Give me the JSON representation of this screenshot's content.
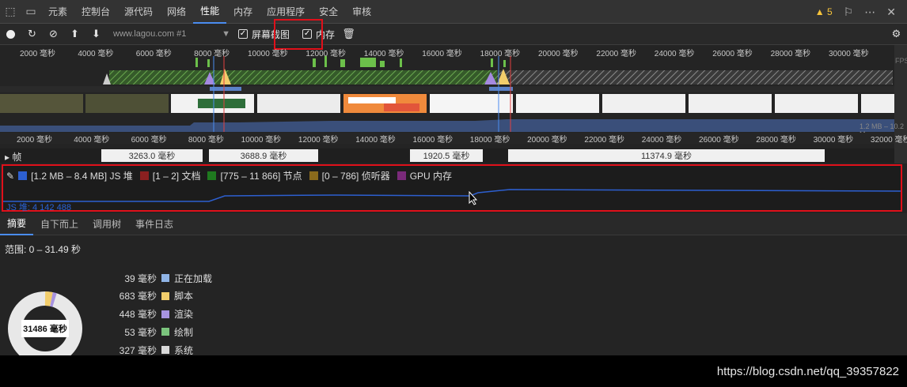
{
  "tabs": {
    "items": [
      "元素",
      "控制台",
      "源代码",
      "网络",
      "性能",
      "内存",
      "应用程序",
      "安全",
      "审核"
    ],
    "active_index": 4,
    "warning_count": "5"
  },
  "toolbar": {
    "url": "www.lagou.com #1",
    "screenshot_label": "屏幕截图",
    "screenshot_checked": true,
    "memory_label": "内存",
    "memory_checked": true
  },
  "overview": {
    "ticks_top": [
      "2000 毫秒",
      "4000 毫秒",
      "6000 毫秒",
      "8000 毫秒",
      "10000 毫秒",
      "12000 毫秒",
      "14000 毫秒",
      "16000 毫秒",
      "18000 毫秒",
      "20000 毫秒",
      "22000 毫秒",
      "24000 毫秒",
      "26000 毫秒",
      "28000 毫秒",
      "30000 毫秒"
    ],
    "ticks_bottom": [
      "2000 毫秒",
      "4000 毫秒",
      "6000 毫秒",
      "8000 毫秒",
      "10000 毫秒",
      "12000 毫秒",
      "14000 毫秒",
      "16000 毫秒",
      "18000 毫秒",
      "20000 毫秒",
      "22000 毫秒",
      "24000 毫秒",
      "26000 毫秒",
      "28000 毫秒",
      "30000 毫秒",
      "32000 毫秒"
    ],
    "fps_label": "FPS",
    "mem_range": "1.2 MB – 10.2 M"
  },
  "frames": {
    "label": "帧",
    "cells": [
      "3263.0 毫秒",
      "3688.9 毫秒",
      "1920.5 毫秒",
      "11374.9 毫秒"
    ]
  },
  "memory": {
    "legend": [
      {
        "label": "[1.2 MB – 8.4 MB] JS 堆",
        "color": "#2d5fd0"
      },
      {
        "label": "[1 – 2] 文档",
        "color": "#8b2020"
      },
      {
        "label": "[775 – 11 866] 节点",
        "color": "#1f7a1f"
      },
      {
        "label": "[0 – 786] 侦听器",
        "color": "#8a6a1c"
      },
      {
        "label": "GPU 内存",
        "color": "#7a2a7a"
      }
    ],
    "js_heap": "JS 堆: 4 142 488"
  },
  "bottom_tabs": [
    "摘要",
    "自下而上",
    "调用树",
    "事件日志"
  ],
  "summary": {
    "range": "范围: 0 – 31.49 秒",
    "total": "31486 毫秒",
    "stats": [
      {
        "value": "39 毫秒",
        "label": "正在加载",
        "color": "#8fb4e6"
      },
      {
        "value": "683 毫秒",
        "label": "脚本",
        "color": "#f2cd6b"
      },
      {
        "value": "448 毫秒",
        "label": "渲染",
        "color": "#a793e0"
      },
      {
        "value": "53 毫秒",
        "label": "绘制",
        "color": "#7bc47d"
      },
      {
        "value": "327 毫秒",
        "label": "系统",
        "color": "#d9d9d9"
      }
    ]
  },
  "watermark": "https://blog.csdn.net/qq_39357822"
}
